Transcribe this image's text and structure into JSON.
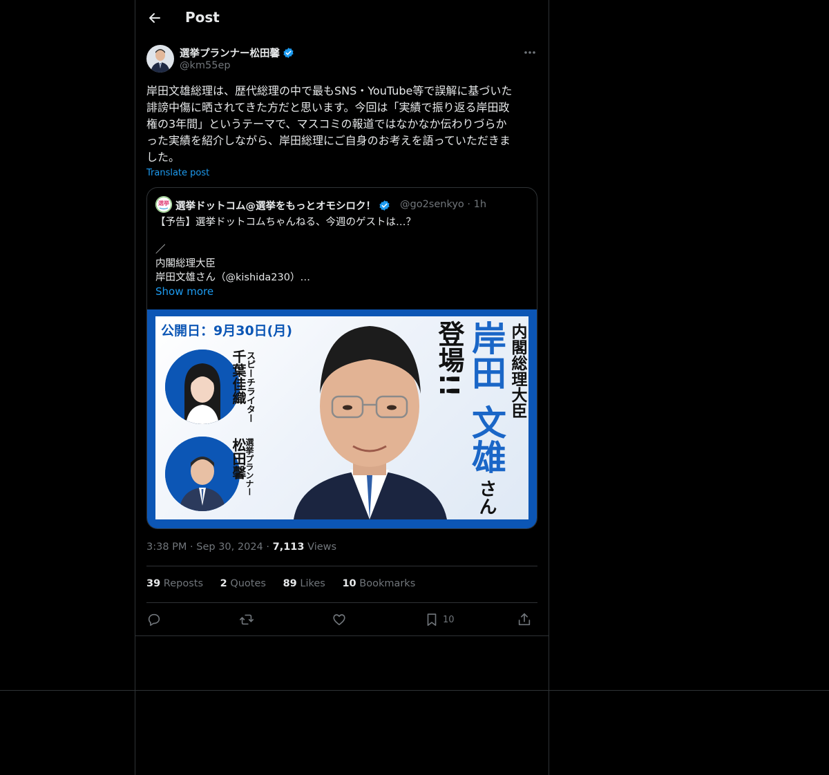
{
  "header": {
    "title": "Post",
    "back_icon": "arrow-left-icon"
  },
  "author": {
    "name": "選挙プランナー松田馨",
    "handle": "@km55ep",
    "verified": true
  },
  "post": {
    "text": "岸田文雄総理は、歴代総理の中で最もSNS・YouTube等で誤解に基づいた\n誹謗中傷に晒されてきた方だと思います。今回は「実績で振り返る岸田政\n権の3年間」というテーマで、マスコミの報道ではなかなか伝わりづらか\nった実績を紹介しながら、岸田総理にご自身のお考えを語っていただきま\nした。",
    "translate_label": "Translate post"
  },
  "quote": {
    "name": "選挙ドットコム@選挙をもっとオモシロク！",
    "handle": "@go2senkyo",
    "time": "1h",
    "handle_time": "@go2senkyo · 1h",
    "text": "【予告】選挙ドットコムちゃんねる、今週のゲストは…？\n\n／\n内閣総理大臣\n岸田文雄さん（@kishida230）…",
    "show_more": "Show more",
    "avatar_text": "選挙",
    "image": {
      "date": "公開日：9月30日(月)",
      "guest1_title": "スピーチライター",
      "guest1_name": "千葉佳織",
      "guest2_title": "選挙プランナー",
      "guest2_name": "松田馨",
      "main_title": "内閣総理大臣",
      "main_name1": "岸田",
      "main_name2": "文雄",
      "main_suffix": "さん",
      "appear": "登場!!"
    }
  },
  "meta": {
    "time": "3:38 PM",
    "date": "Sep 30, 2024",
    "views_count": "7,113",
    "views_label": "Views"
  },
  "stats": {
    "reposts_count": "39",
    "reposts_label": "Reposts",
    "quotes_count": "2",
    "quotes_label": "Quotes",
    "likes_count": "89",
    "likes_label": "Likes",
    "bookmarks_count": "10",
    "bookmarks_label": "Bookmarks"
  },
  "actions": {
    "reply_icon": "reply-icon",
    "repost_icon": "repost-icon",
    "like_icon": "heart-icon",
    "bookmark_icon": "bookmark-icon",
    "bookmark_count": "10",
    "share_icon": "share-icon"
  },
  "colors": {
    "background": "#000000",
    "text": "#e7e9ea",
    "muted": "#71767b",
    "accent": "#1d9bf0",
    "border": "#2f3336",
    "banner_blue": "#0c56b5"
  }
}
